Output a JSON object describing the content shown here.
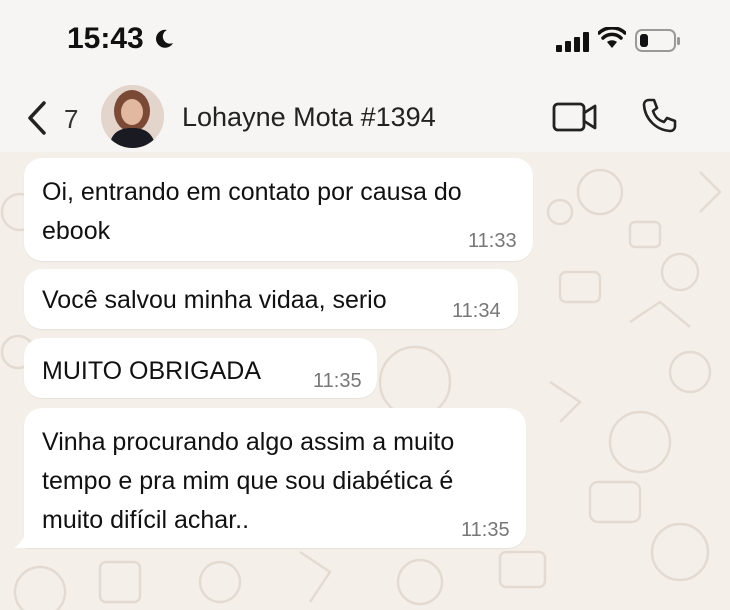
{
  "status": {
    "time": "15:43"
  },
  "header": {
    "back_count": "7",
    "contact_name": "Lohayne Mota #1394"
  },
  "messages": [
    {
      "lines": [
        "Oi, entrando em contato por causa do",
        "ebook"
      ],
      "time": "11:33"
    },
    {
      "lines": [
        "Você salvou minha vidaa, serio"
      ],
      "time": "11:34"
    },
    {
      "lines": [
        "MUITO OBRIGADA"
      ],
      "time": "11:35"
    },
    {
      "lines": [
        "Vinha procurando algo assim a muito",
        "tempo e pra mim que sou diabética é",
        "muito difícil achar.."
      ],
      "time": "11:35"
    }
  ],
  "colors": {
    "bubble": "#ffffff",
    "chat_background": "#f4efe8",
    "header": "#f6f5f3"
  },
  "icons": [
    "moon-icon",
    "signal-icon",
    "wifi-icon",
    "battery-icon",
    "back-chevron-icon",
    "video-call-icon",
    "phone-call-icon"
  ]
}
